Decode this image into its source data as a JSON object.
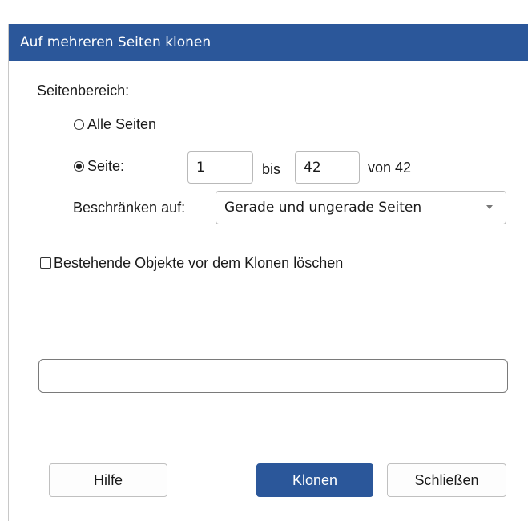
{
  "dialog": {
    "title": "Auf mehreren Seiten klonen",
    "accent_color": "#2b579a"
  },
  "range": {
    "section_label": "Seitenbereich:",
    "all_pages_label": "Alle Seiten",
    "all_pages_selected": false,
    "page_label": "Seite:",
    "page_selected": true,
    "from_value": "1",
    "to_label": "bis",
    "to_value": "42",
    "of_label": "von 42"
  },
  "restrict": {
    "label": "Beschränken auf:",
    "selected": "Gerade und ungerade Seiten"
  },
  "delete_existing": {
    "label": "Bestehende Objekte vor dem Klonen löschen",
    "checked": false
  },
  "progress": {
    "value": 0
  },
  "buttons": {
    "help": "Hilfe",
    "clone": "Klonen",
    "close": "Schließen"
  }
}
